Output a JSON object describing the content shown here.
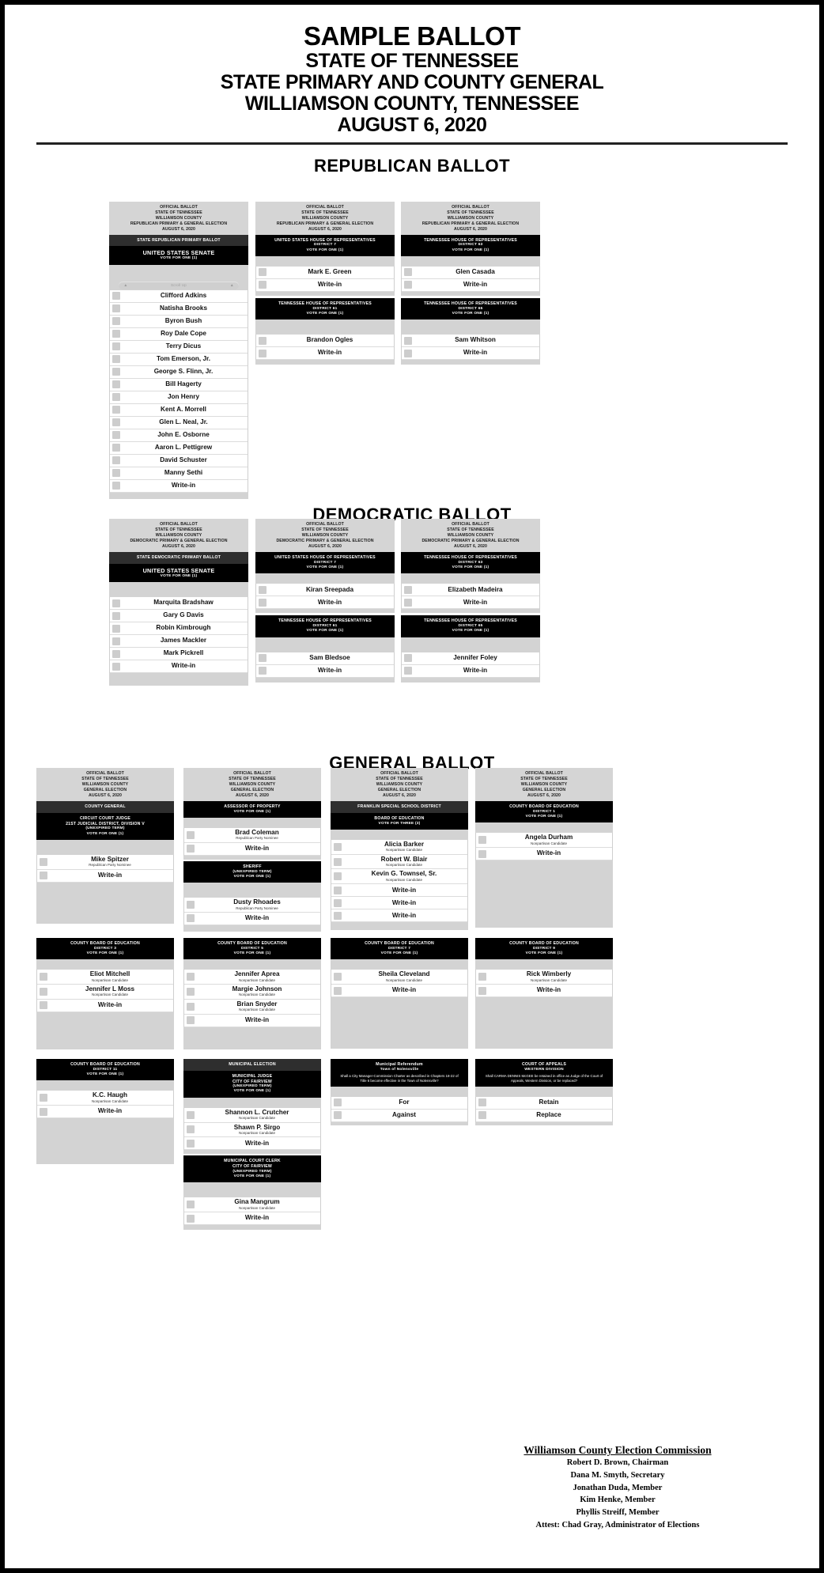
{
  "header": {
    "line1": "SAMPLE BALLOT",
    "line2": "STATE OF TENNESSEE",
    "line3": "STATE PRIMARY AND COUNTY GENERAL",
    "line4": "WILLIAMSON COUNTY, TENNESSEE",
    "line5": "AUGUST 6, 2020"
  },
  "sections": {
    "republican_title": "REPUBLICAN BALLOT",
    "democratic_title": "DEMOCRATIC BALLOT",
    "general_title": "GENERAL BALLOT"
  },
  "official_headers": {
    "republican": [
      "OFFICIAL BALLOT",
      "STATE OF TENNESSEE",
      "WILLIAMSON COUNTY",
      "REPUBLICAN PRIMARY & GENERAL ELECTION",
      "AUGUST 6, 2020"
    ],
    "democratic": [
      "OFFICIAL BALLOT",
      "STATE OF TENNESSEE",
      "WILLIAMSON COUNTY",
      "DEMOCRATIC PRIMARY & GENERAL ELECTION",
      "AUGUST 6, 2020"
    ],
    "general": [
      "OFFICIAL BALLOT",
      "STATE OF TENNESSEE",
      "WILLIAMSON COUNTY",
      "GENERAL ELECTION",
      "AUGUST 6, 2020"
    ]
  },
  "labels": {
    "vote_for_one": "VOTE FOR ONE (1)",
    "vote_for_three": "VOTE FOR THREE (3)",
    "write_in": "Write-in",
    "scroll_up": "Scroll Up",
    "republican_party_nominee": "Republican Party Nominee",
    "nonpartisan_candidate": "Nonpartisan Candidate",
    "unexpired_term": "(UNEXPIRED TERM)"
  },
  "republican": {
    "senate": {
      "banner": "STATE REPUBLICAN PRIMARY BALLOT",
      "title": "UNITED STATES SENATE",
      "vote_for": "VOTE FOR ONE (1)",
      "candidates": [
        "Clifford Adkins",
        "Natisha Brooks",
        "Byron Bush",
        "Roy Dale Cope",
        "Terry Dicus",
        "Tom Emerson, Jr.",
        "George S. Flinn, Jr.",
        "Bill Hagerty",
        "Jon Henry",
        "Kent A. Morrell",
        "Glen L. Neal, Jr.",
        "John E. Osborne",
        "Aaron L. Pettigrew",
        "David Schuster",
        "Manny Sethi",
        "Write-in"
      ]
    },
    "us_house_7": {
      "title": "UNITED STATES HOUSE OF REPRESENTATIVES",
      "district": "DISTRICT 7",
      "vote_for": "VOTE FOR ONE (1)",
      "candidates": [
        "Mark E. Green",
        "Write-in"
      ]
    },
    "tn_house_61": {
      "title": "TENNESSEE HOUSE OF REPRESENTATIVES",
      "district": "DISTRICT 61",
      "vote_for": "VOTE FOR ONE (1)",
      "candidates": [
        "Brandon Ogles",
        "Write-in"
      ]
    },
    "tn_house_63": {
      "title": "TENNESSEE HOUSE OF REPRESENTATIVES",
      "district": "DISTRICT 63",
      "vote_for": "VOTE FOR ONE (1)",
      "candidates": [
        "Glen Casada",
        "Write-in"
      ]
    },
    "tn_house_65": {
      "title": "TENNESSEE HOUSE OF REPRESENTATIVES",
      "district": "DISTRICT 65",
      "vote_for": "VOTE FOR ONE (1)",
      "candidates": [
        "Sam Whitson",
        "Write-in"
      ]
    }
  },
  "democratic": {
    "senate": {
      "banner": "STATE DEMOCRATIC PRIMARY BALLOT",
      "title": "UNITED STATES SENATE",
      "vote_for": "VOTE FOR ONE (1)",
      "candidates": [
        "Marquita Bradshaw",
        "Gary G Davis",
        "Robin Kimbrough",
        "James Mackler",
        "Mark Pickrell",
        "Write-in"
      ]
    },
    "us_house_7": {
      "title": "UNITED STATES HOUSE OF REPRESENTATIVES",
      "district": "DISTRICT 7",
      "vote_for": "VOTE FOR ONE (1)",
      "candidates": [
        "Kiran Sreepada",
        "Write-in"
      ]
    },
    "tn_house_61": {
      "title": "TENNESSEE HOUSE OF REPRESENTATIVES",
      "district": "DISTRICT 61",
      "vote_for": "VOTE FOR ONE (1)",
      "candidates": [
        "Sam Bledsoe",
        "Write-in"
      ]
    },
    "tn_house_63": {
      "title": "TENNESSEE HOUSE OF REPRESENTATIVES",
      "district": "DISTRICT 63",
      "vote_for": "VOTE FOR ONE (1)",
      "candidates": [
        "Elizabeth Madeira",
        "Write-in"
      ]
    },
    "tn_house_65": {
      "title": "TENNESSEE HOUSE OF REPRESENTATIVES",
      "district": "DISTRICT 65",
      "vote_for": "VOTE FOR ONE (1)",
      "candidates": [
        "Jennifer Foley",
        "Write-in"
      ]
    }
  },
  "general": {
    "circuit_judge": {
      "banner": "COUNTY GENERAL",
      "title": "CIRCUIT COURT JUDGE",
      "sub1": "21ST JUDICIAL DISTRICT, DIVISION V",
      "sub2": "(UNEXPIRED TERM)",
      "vote_for": "VOTE FOR ONE (1)",
      "candidates": [
        {
          "name": "Mike Spitzer",
          "sub": "Republican Party Nominee"
        },
        {
          "name": "Write-in",
          "sub": ""
        }
      ]
    },
    "assessor": {
      "title": "ASSESSOR OF PROPERTY",
      "vote_for": "VOTE FOR ONE (1)",
      "candidates": [
        {
          "name": "Brad Coleman",
          "sub": "Republican Party Nominee"
        },
        {
          "name": "Write-in",
          "sub": ""
        }
      ]
    },
    "sheriff": {
      "title": "SHERIFF",
      "sub1": "(UNEXPIRED TERM)",
      "vote_for": "VOTE FOR ONE (1)",
      "candidates": [
        {
          "name": "Dusty Rhoades",
          "sub": "Republican Party Nominee"
        },
        {
          "name": "Write-in",
          "sub": ""
        }
      ]
    },
    "franklin_school": {
      "banner": "FRANKLIN SPECIAL SCHOOL DISTRICT",
      "title": "BOARD OF EDUCATION",
      "vote_for": "VOTE FOR THREE (3)",
      "candidates": [
        {
          "name": "Alicia Barker",
          "sub": "Nonpartisan Candidate"
        },
        {
          "name": "Robert W. Blair",
          "sub": "Nonpartisan Candidate"
        },
        {
          "name": "Kevin G. Townsel, Sr.",
          "sub": "Nonpartisan Candidate"
        },
        {
          "name": "Write-in",
          "sub": ""
        },
        {
          "name": "Write-in",
          "sub": ""
        },
        {
          "name": "Write-in",
          "sub": ""
        }
      ]
    },
    "boe_1": {
      "title": "COUNTY BOARD OF EDUCATION",
      "district": "DISTRICT 1",
      "vote_for": "VOTE FOR ONE (1)",
      "candidates": [
        {
          "name": "Angela Durham",
          "sub": "Nonpartisan Candidate"
        },
        {
          "name": "Write-in",
          "sub": ""
        }
      ]
    },
    "boe_3": {
      "title": "COUNTY BOARD OF EDUCATION",
      "district": "DISTRICT 3",
      "vote_for": "VOTE FOR ONE (1)",
      "candidates": [
        {
          "name": "Eliot Mitchell",
          "sub": "Nonpartisan Candidate"
        },
        {
          "name": "Jennifer L Moss",
          "sub": "Nonpartisan Candidate"
        },
        {
          "name": "Write-in",
          "sub": ""
        }
      ]
    },
    "boe_5": {
      "title": "COUNTY BOARD OF EDUCATION",
      "district": "DISTRICT 5",
      "vote_for": "VOTE FOR ONE (1)",
      "candidates": [
        {
          "name": "Jennifer Aprea",
          "sub": "Nonpartisan Candidate"
        },
        {
          "name": "Margie Johnson",
          "sub": "Nonpartisan Candidate"
        },
        {
          "name": "Brian Snyder",
          "sub": "Nonpartisan Candidate"
        },
        {
          "name": "Write-in",
          "sub": ""
        }
      ]
    },
    "boe_7": {
      "title": "COUNTY BOARD OF EDUCATION",
      "district": "DISTRICT 7",
      "vote_for": "VOTE FOR ONE (1)",
      "candidates": [
        {
          "name": "Sheila Cleveland",
          "sub": "Nonpartisan Candidate"
        },
        {
          "name": "Write-in",
          "sub": ""
        }
      ]
    },
    "boe_9": {
      "title": "COUNTY BOARD OF EDUCATION",
      "district": "DISTRICT 9",
      "vote_for": "VOTE FOR ONE (1)",
      "candidates": [
        {
          "name": "Rick Wimberly",
          "sub": "Nonpartisan Candidate"
        },
        {
          "name": "Write-in",
          "sub": ""
        }
      ]
    },
    "boe_11": {
      "title": "COUNTY BOARD OF EDUCATION",
      "district": "DISTRICT 11",
      "vote_for": "VOTE FOR ONE (1)",
      "candidates": [
        {
          "name": "K.C. Haugh",
          "sub": "Nonpartisan Candidate"
        },
        {
          "name": "Write-in",
          "sub": ""
        }
      ]
    },
    "municipal_judge": {
      "banner": "MUNICIPAL ELECTION",
      "title": "MUNICIPAL JUDGE",
      "sub1": "CITY OF FAIRVIEW",
      "sub2": "(UNEXPIRED TERM)",
      "vote_for": "VOTE FOR ONE (1)",
      "candidates": [
        {
          "name": "Shannon L. Crutcher",
          "sub": "Nonpartisan Candidate"
        },
        {
          "name": "Shawn P. Sirgo",
          "sub": "Nonpartisan Candidate"
        },
        {
          "name": "Write-in",
          "sub": ""
        }
      ]
    },
    "municipal_clerk": {
      "title": "MUNICIPAL COURT CLERK",
      "sub1": "CITY OF FAIRVIEW",
      "sub2": "(UNEXPIRED TERM)",
      "vote_for": "VOTE FOR ONE (1)",
      "candidates": [
        {
          "name": "Gina Mangrum",
          "sub": "Nonpartisan Candidate"
        },
        {
          "name": "Write-in",
          "sub": ""
        }
      ]
    },
    "referendum": {
      "title": "Municipal Referendum",
      "subtitle": "Town of Nolensville",
      "question": "Shall a City Manager-Commission Charter as described in Chapters 18-22 of Title 6 become effective in the Town of Nolensville?",
      "options": [
        "For",
        "Against"
      ]
    },
    "court_of_appeals": {
      "title": "COURT OF APPEALS",
      "subtitle": "WESTERN DIVISION",
      "question": "Shall CARMA DENNIS McGEE be retained in office as Judge of the Court of Appeals, Western Division, or be replaced?",
      "options": [
        "Retain",
        "Replace"
      ]
    }
  },
  "commission": {
    "title": "Williamson County Election Commission",
    "lines": [
      "Robert D. Brown, Chairman",
      "Dana M. Smyth, Secretary",
      "Jonathan Duda, Member",
      "Kim Henke, Member",
      "Phyllis Streiff, Member",
      "Attest:  Chad Gray, Administrator of Elections"
    ]
  }
}
